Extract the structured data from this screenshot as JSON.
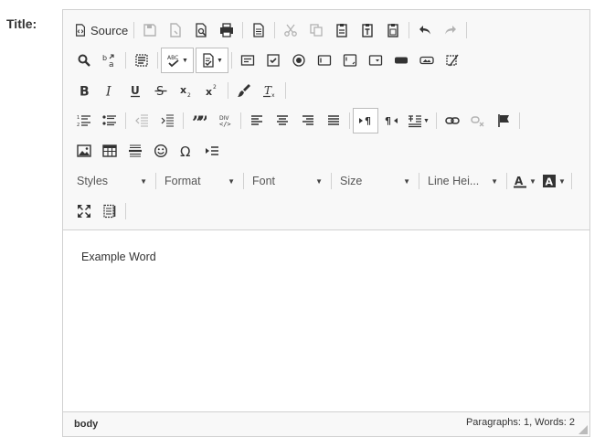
{
  "field": {
    "label": "Title:"
  },
  "toolbar": {
    "source_label": "Source",
    "styles_label": "Styles",
    "format_label": "Format",
    "font_label": "Font",
    "size_label": "Size",
    "line_height_label": "Line Hei...",
    "dropdown_arrow": "▼",
    "accent_color": "#333333",
    "border_color": "#d1d1d1"
  },
  "content": {
    "text": "Example Word"
  },
  "statusbar": {
    "path": "body",
    "count": "Paragraphs: 1, Words: 2"
  }
}
